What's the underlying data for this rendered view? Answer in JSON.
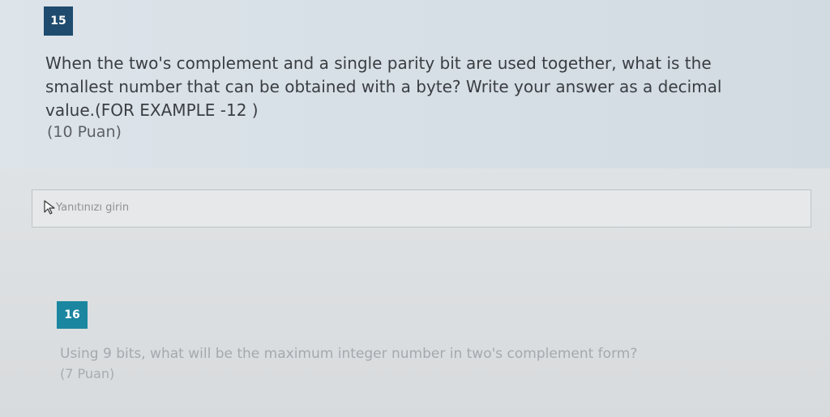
{
  "question_1": {
    "number": "15",
    "text": "When the two's complement and a single parity bit are used together, what is the smallest number that can be obtained with a byte? Write your answer as a decimal value.(FOR EXAMPLE -12 )",
    "points": "(10 Puan)",
    "answer_placeholder": "Yanıtınızı girin"
  },
  "question_2": {
    "number": "16",
    "text": "Using 9 bits, what will be the maximum integer number in two's complement form?",
    "points": "(7 Puan)"
  },
  "icons": {
    "cursor": "mouse-pointer-icon"
  },
  "colors": {
    "badge_15": "#1f4b6e",
    "badge_16": "#1a86a0"
  }
}
